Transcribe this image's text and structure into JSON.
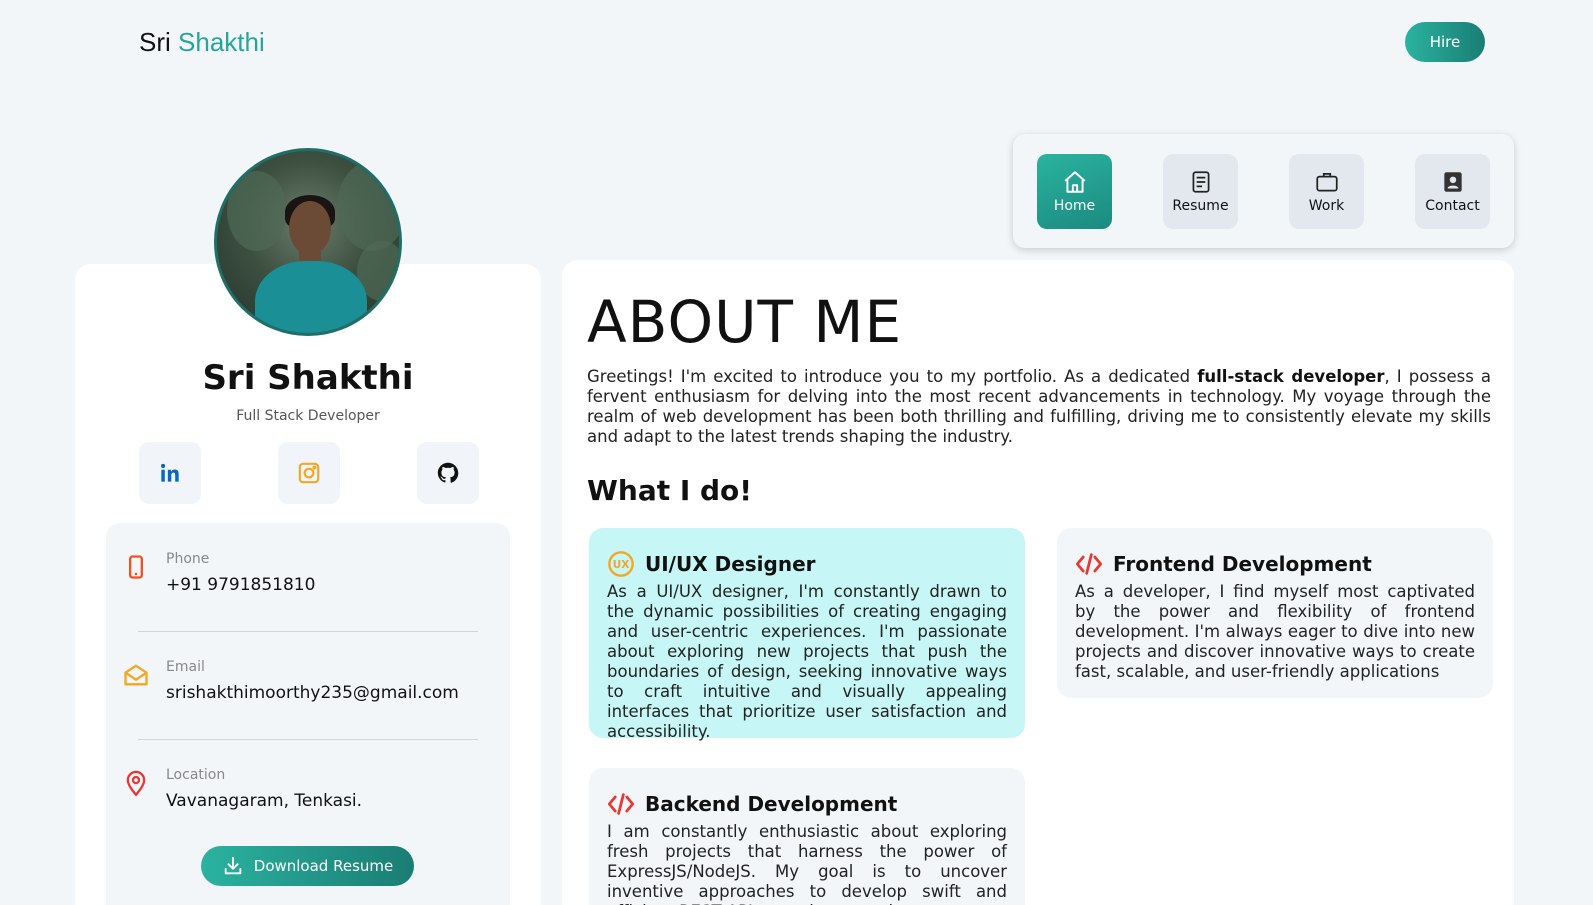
{
  "header": {
    "brand_first": "Sri",
    "brand_second": "Shakthi",
    "hire_label": "Hire"
  },
  "nav": {
    "items": [
      {
        "label": "Home",
        "icon": "home-icon",
        "active": true
      },
      {
        "label": "Resume",
        "icon": "document-icon",
        "active": false
      },
      {
        "label": "Work",
        "icon": "briefcase-icon",
        "active": false
      },
      {
        "label": "Contact",
        "icon": "contact-card-icon",
        "active": false
      }
    ]
  },
  "profile": {
    "name": "Sri Shakthi",
    "role": "Full Stack Developer",
    "social": [
      {
        "icon": "linkedin-icon",
        "color": "#0a66c2"
      },
      {
        "icon": "instagram-icon",
        "color": "#f5a623"
      },
      {
        "icon": "github-icon",
        "color": "#111111"
      }
    ],
    "contact": [
      {
        "label": "Phone",
        "value": "+91 9791851810",
        "icon": "phone-icon",
        "color": "#f4511e"
      },
      {
        "label": "Email",
        "value": "srishakthimoorthy235@gmail.com",
        "icon": "envelope-icon",
        "color": "#f5a623"
      },
      {
        "label": "Location",
        "value": "Vavanagaram, Tenkasi.",
        "icon": "location-pin-icon",
        "color": "#e53935"
      }
    ],
    "download_label": "Download Resume"
  },
  "about": {
    "title": "ABOUT ME",
    "text_before": "Greetings! I'm excited to introduce you to my portfolio. As a dedicated ",
    "text_bold": "full-stack developer",
    "text_after": ", I possess a fervent enthusiasm for delving into the most recent advancements in technology. My voyage through the realm of web development has been both thrilling and fulfilling, driving me to consistently elevate my skills and adapt to the latest trends shaping the industry.",
    "whatido_title": "What I do!",
    "services": [
      {
        "title": "UI/UX Designer",
        "icon": "ux-icon",
        "bg": "#c6f6f6",
        "desc": "As a UI/UX designer, I'm constantly drawn to the dynamic possibilities of creating engaging and user-centric experiences. I'm passionate about exploring new projects that push the boundaries of design, seeking innovative ways to craft intuitive and visually appealing interfaces that prioritize user satisfaction and accessibility."
      },
      {
        "title": "Frontend Development",
        "icon": "code-icon",
        "bg": "#f3f6f9",
        "desc": "As a developer, I find myself most captivated by the power and flexibility of frontend development. I'm always eager to dive into new projects and discover innovative ways to create fast, scalable, and user-friendly applications"
      },
      {
        "title": "Backend Development",
        "icon": "code-icon",
        "bg": "#f3f6f9",
        "desc": "I am constantly enthusiastic about exploring fresh projects that harness the power of ExpressJS/NodeJS. My goal is to uncover inventive approaches to develop swift and efficient REST APIs catering to various"
      }
    ]
  }
}
